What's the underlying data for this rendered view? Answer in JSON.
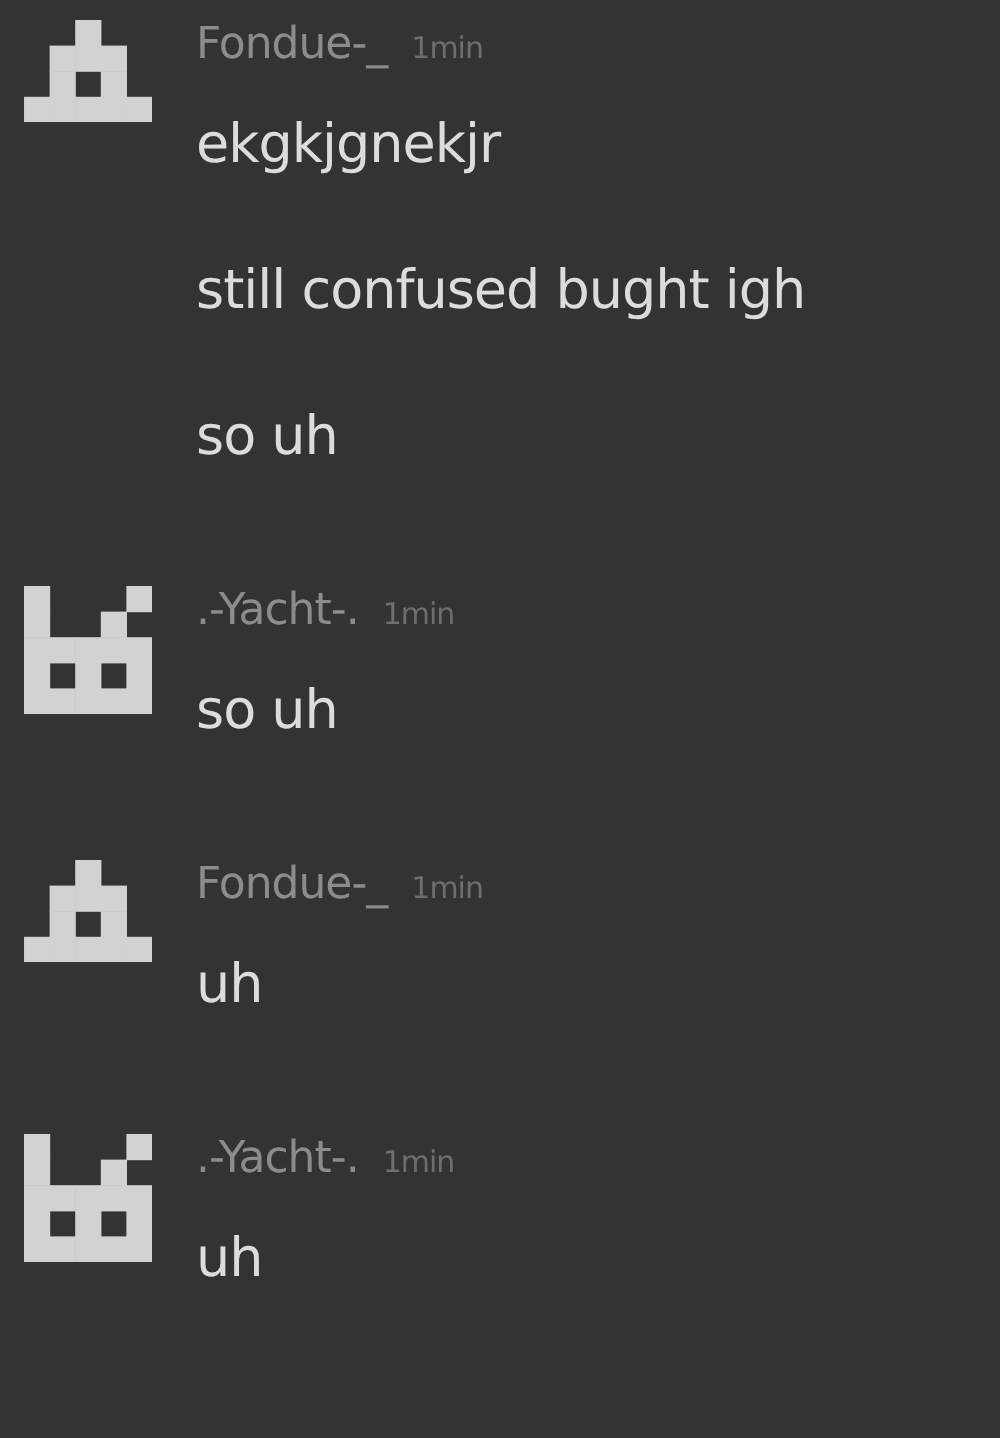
{
  "messages": [
    {
      "kind": "tower",
      "username": "Fondue-_",
      "time": "1min",
      "lines": [
        "ekgkjgnekjr",
        "still confused bught igh",
        "so uh"
      ]
    },
    {
      "kind": "factory",
      "username": ".-Yacht-.",
      "time": "1min",
      "lines": [
        "so uh"
      ]
    },
    {
      "kind": "tower",
      "username": "Fondue-_",
      "time": "1min",
      "lines": [
        "uh"
      ]
    },
    {
      "kind": "factory",
      "username": ".-Yacht-.",
      "time": "1min",
      "lines": [
        "uh"
      ]
    }
  ]
}
